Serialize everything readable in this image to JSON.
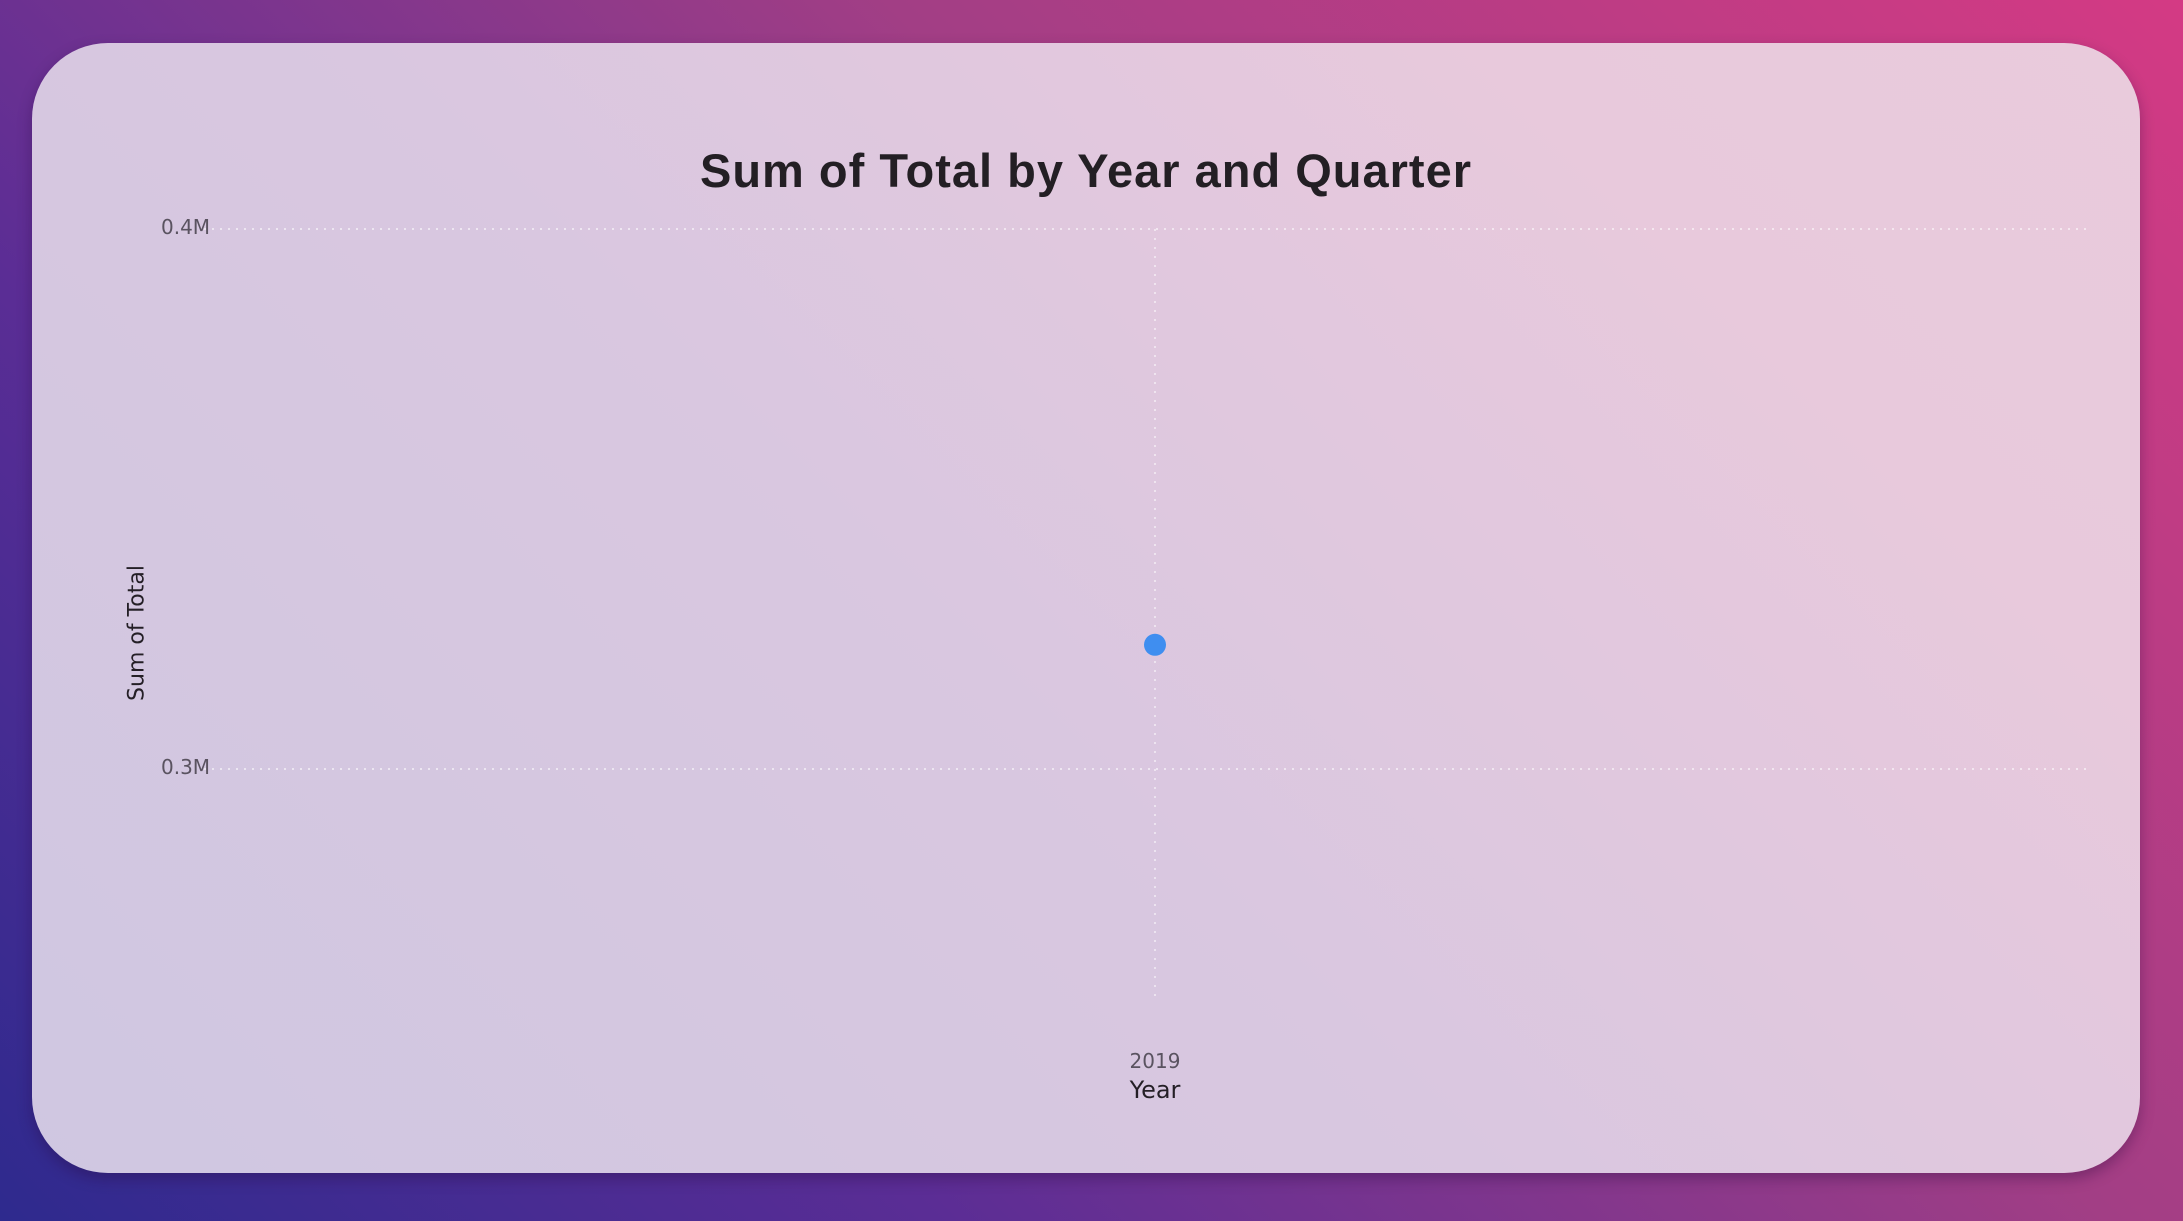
{
  "chart_data": {
    "type": "scatter",
    "title": "Sum of Total by Year and Quarter",
    "xlabel": "Year",
    "ylabel": "Sum of Total",
    "categories": [
      "2019"
    ],
    "x": [
      "2019"
    ],
    "values": [
      323000
    ],
    "y_ticks": [
      {
        "value": 400000,
        "label": "0.4M"
      },
      {
        "value": 300000,
        "label": "0.3M"
      }
    ],
    "ylim": [
      250000,
      400000
    ],
    "grid": true,
    "point_color": "#3f8ef0"
  }
}
